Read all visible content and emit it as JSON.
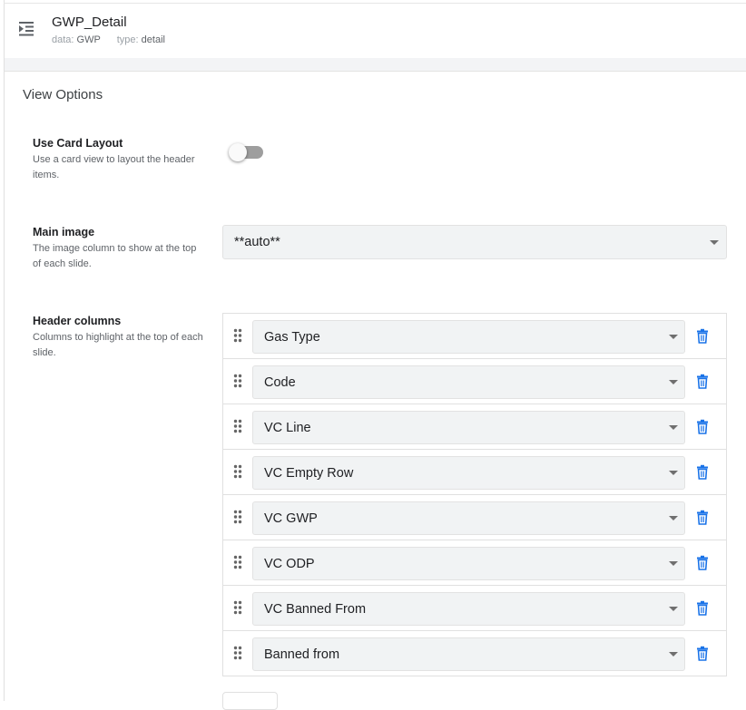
{
  "header": {
    "title": "GWP_Detail",
    "data_label": "data:",
    "data_value": "GWP",
    "type_label": "type:",
    "type_value": "detail",
    "icon": "format-indent-icon"
  },
  "section": {
    "title": "View Options"
  },
  "use_card_layout": {
    "label": "Use Card Layout",
    "description": "Use a card view to layout the header items.",
    "enabled": false
  },
  "main_image": {
    "label": "Main image",
    "description": "The image column to show at the top of each slide.",
    "value": "**auto**"
  },
  "header_columns": {
    "label": "Header columns",
    "description": "Columns to highlight at the top of each slide.",
    "items": [
      "Gas Type",
      "Code",
      "VC Line",
      "VC Empty Row",
      "VC GWP",
      "VC ODP",
      "VC Banned From",
      "Banned from"
    ]
  },
  "colors": {
    "accent": "#1a73e8",
    "toggle_track": "#9e9e9e",
    "select_bg": "#f1f3f4"
  }
}
